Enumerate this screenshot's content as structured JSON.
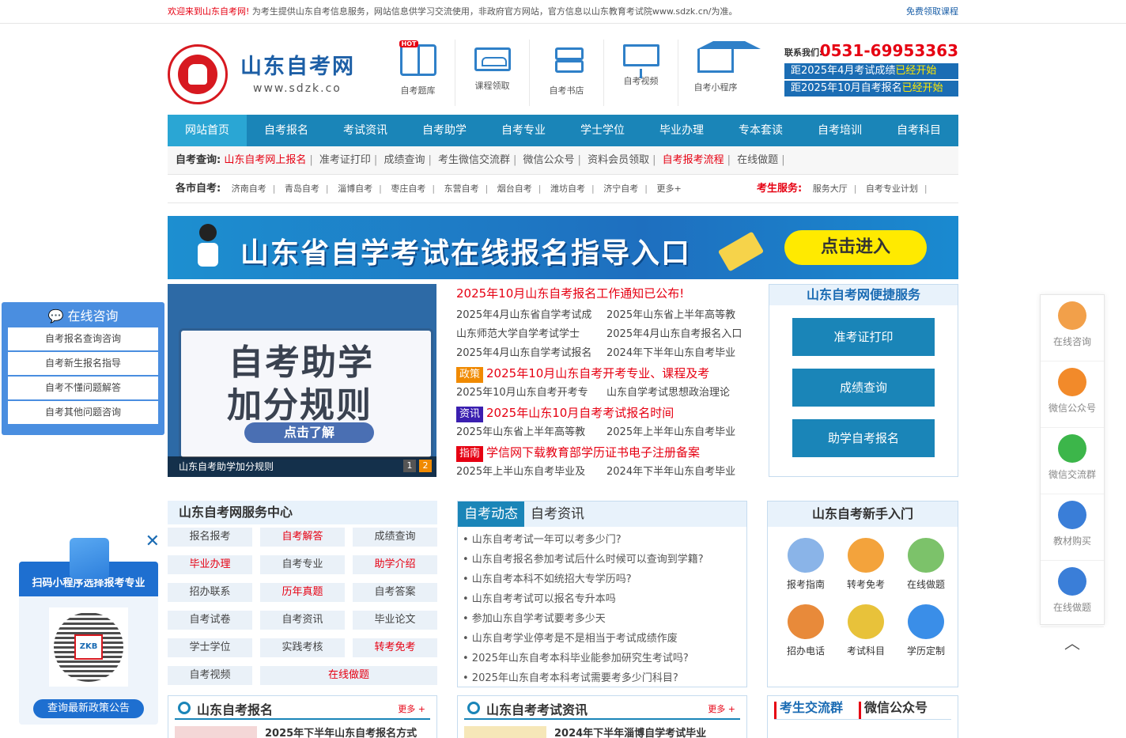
{
  "topbar": {
    "welcome": "欢迎来到山东自考网!",
    "notice": "为考生提供山东自考信息服务，网站信息供学习交流使用，非政府官方网站，官方信息以山东教育考试院www.sdzk.cn/为准。",
    "right_link": "免费领取课程"
  },
  "header": {
    "site_name": "山东自考网",
    "domain": "www.sdzk.co",
    "quick": [
      {
        "label": "自考题库",
        "icon": "book-icon",
        "badge": "HOT"
      },
      {
        "label": "课程领取",
        "icon": "classroom-icon"
      },
      {
        "label": "自考书店",
        "icon": "bookstore-icon"
      },
      {
        "label": "自考视频",
        "icon": "video-icon"
      },
      {
        "label": "自考小程序",
        "icon": "mini-program-icon"
      }
    ],
    "contact_label": "联系我们:",
    "phone": "0531-69953363",
    "bar1_text": "距2025年4月考试成绩",
    "bar1_hl": "已经开始",
    "bar2_text": "距2025年10月自考报名",
    "bar2_hl": "已经开始"
  },
  "nav": [
    "网站首页",
    "自考报名",
    "考试资讯",
    "自考助学",
    "自考专业",
    "学士学位",
    "毕业办理",
    "专本套读",
    "自考培训",
    "自考科目"
  ],
  "query": {
    "heading": "自考查询:",
    "items": [
      {
        "label": "山东自考网上报名",
        "red": true
      },
      {
        "label": "准考证打印"
      },
      {
        "label": "成绩查询"
      },
      {
        "label": "考生微信交流群"
      },
      {
        "label": "微信公众号"
      },
      {
        "label": "资料会员领取"
      },
      {
        "label": "自考报考流程",
        "red": true
      },
      {
        "label": "在线做题"
      }
    ]
  },
  "cities": {
    "heading": "各市自考:",
    "items": [
      "济南自考",
      "青岛自考",
      "淄博自考",
      "枣庄自考",
      "东营自考",
      "烟台自考",
      "潍坊自考",
      "济宁自考",
      "更多+"
    ],
    "service_heading": "考生服务:",
    "service_items": [
      "服务大厅",
      "自考专业计划"
    ]
  },
  "banner": {
    "title": "山东省自学考试在线报名指导入口",
    "button": "点击进入"
  },
  "slider": {
    "line1": "自考助学",
    "line2": "加分规则",
    "cta": "点击了解",
    "caption": "山东自考助学加分规则",
    "pages": [
      "1",
      "2"
    ]
  },
  "news": {
    "top": "2025年10月山东自考报名工作通知已公布!",
    "pairs1": [
      [
        "2025年4月山东省自学考试成",
        "2025年山东省上半年高等教"
      ],
      [
        "山东师范大学自学考试学士",
        "2025年4月山东自考报名入口"
      ],
      [
        "2025年4月山东自学考试报名",
        "2024年下半年山东自考毕业"
      ]
    ],
    "tag1": {
      "tag": "政策",
      "text": "2025年10月山东自考开考专业、课程及考"
    },
    "pair2": [
      "2025年10月山东自考开考专",
      "山东自学考试思想政治理论"
    ],
    "tag2": {
      "tag": "资讯",
      "text": "2025年山东10月自考考试报名时间"
    },
    "pair3": [
      "2025年山东省上半年高等教",
      "2025年上半年山东自考毕业"
    ],
    "tag3": {
      "tag": "指南",
      "text": "学信网下载教育部学历证书电子注册备案"
    },
    "pair4": [
      "2025年上半山东自考毕业及",
      "2024年下半年山东自考毕业"
    ]
  },
  "service": {
    "heading": "山东自考网便捷服务",
    "buttons": [
      "准考证打印",
      "成绩查询",
      "助学自考报名"
    ]
  },
  "center": {
    "heading": "山东自考网服务中心",
    "cells": [
      {
        "label": "报名报考"
      },
      {
        "label": "自考解答",
        "red": true
      },
      {
        "label": "成绩查询"
      },
      {
        "label": "毕业办理",
        "red": true
      },
      {
        "label": "自考专业"
      },
      {
        "label": "助学介绍",
        "red": true
      },
      {
        "label": "招办联系"
      },
      {
        "label": "历年真题",
        "red": true
      },
      {
        "label": "自考答案"
      },
      {
        "label": "自考试卷"
      },
      {
        "label": "自考资讯"
      },
      {
        "label": "毕业论文"
      },
      {
        "label": "学士学位"
      },
      {
        "label": "实践考核"
      },
      {
        "label": "转考免考",
        "red": true
      },
      {
        "label": "自考视频"
      },
      {
        "label": "在线做题",
        "red": true,
        "wide": true
      }
    ]
  },
  "dynamic": {
    "tabs": [
      "自考动态",
      "自考资讯"
    ],
    "items": [
      "• 山东自考考试一年可以考多少门?",
      "• 山东自考报名参加考试后什么时候可以查询到学籍?",
      "• 山东自考本科不如统招大专学历吗?",
      "• 山东自考考试可以报名专升本吗",
      "• 参加山东自学考试要考多少天",
      "• 山东自考学业停考是不是相当于考试成绩作废",
      "• 2025年山东自考本科毕业能参加研究生考试吗?",
      "• 2025年山东自考本科考试需要考多少门科目?"
    ]
  },
  "newbie": {
    "heading": "山东自考新手入门",
    "cells": [
      {
        "label": "报考指南",
        "icon": "guide-icon",
        "color": "#8ab4e8"
      },
      {
        "label": "转考免考",
        "icon": "transfer-icon",
        "color": "#f3a33c"
      },
      {
        "label": "在线做题",
        "icon": "pencil-icon",
        "color": "#7cc26a"
      },
      {
        "label": "招办电话",
        "icon": "phone-icon",
        "color": "#e88a3a"
      },
      {
        "label": "考试科目",
        "icon": "clock-icon",
        "color": "#e8c23a"
      },
      {
        "label": "学历定制",
        "icon": "logo-s-icon",
        "color": "#3a8ee8"
      }
    ]
  },
  "row3": {
    "box1_title": "山东自考报名",
    "box1_more": "更多 +",
    "box1_line": "2025年下半年山东自考报名方式",
    "box2_title": "山东自考考试资讯",
    "box2_more": "更多 +",
    "box2_line": "2024年下半年淄博自学考试毕业",
    "box3_tabs": [
      "考生交流群",
      "微信公众号"
    ]
  },
  "consult": {
    "heading": "在线咨询",
    "items": [
      "自考报名查询咨询",
      "自考新生报名指导",
      "自考不懂问题解答",
      "自考其他问题咨询"
    ]
  },
  "mini": {
    "title": "扫码小程序选择报考专业",
    "qr_logo": "ZKB",
    "button": "查询最新政策公告"
  },
  "rbar": [
    {
      "label": "在线咨询",
      "icon": "service-agent-icon",
      "color": "#f2a04a"
    },
    {
      "label": "微信公众号",
      "icon": "qr-icon",
      "color": "#f28a2a"
    },
    {
      "label": "微信交流群",
      "icon": "wechat-icon",
      "color": "#3cb64a"
    },
    {
      "label": "教材购买",
      "icon": "cart-icon",
      "color": "#3a7ed8"
    },
    {
      "label": "在线做题",
      "icon": "edit-icon",
      "color": "#3a7ed8"
    }
  ]
}
